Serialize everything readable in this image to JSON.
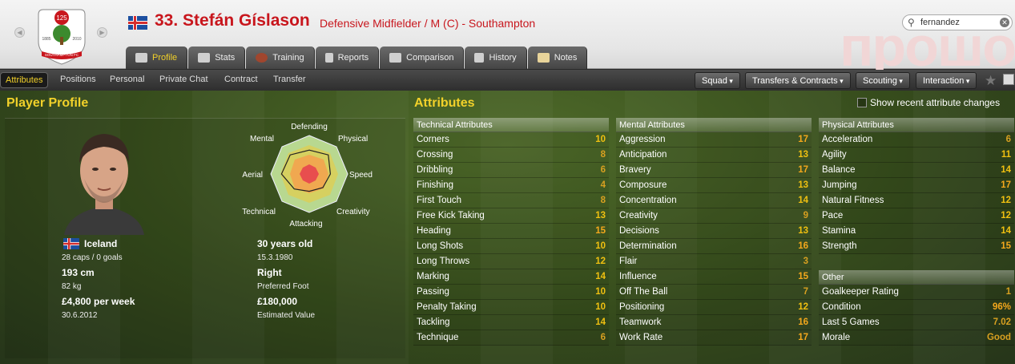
{
  "header": {
    "player_number_name": "33. Stefán Gíslason",
    "role_club": "Defensive Midfielder / M (C) - Southampton",
    "crest": {
      "top_number": "125",
      "year_left": "1885",
      "year_right": "2010",
      "banner": "SOUTHAMPTON FC"
    },
    "search_value": "fernandez",
    "watermark": "прошо",
    "flag_icon": "iceland-flag-icon"
  },
  "tabs": [
    {
      "label": "Profile",
      "icon": "profile-icon",
      "active": true
    },
    {
      "label": "Stats",
      "icon": "stats-icon"
    },
    {
      "label": "Training",
      "icon": "training-icon"
    },
    {
      "label": "Reports",
      "icon": "reports-icon"
    },
    {
      "label": "Comparison",
      "icon": "comparison-icon"
    },
    {
      "label": "History",
      "icon": "history-icon"
    },
    {
      "label": "Notes",
      "icon": "notes-icon"
    }
  ],
  "subtabs": [
    "Attributes",
    "Positions",
    "Personal",
    "Private Chat",
    "Contract",
    "Transfer"
  ],
  "menus": [
    "Squad",
    "Transfers & Contracts",
    "Scouting",
    "Interaction"
  ],
  "profile": {
    "title": "Player Profile",
    "radar_labels": [
      "Defending",
      "Physical",
      "Speed",
      "Creativity",
      "Attacking",
      "Technical",
      "Aerial",
      "Mental"
    ],
    "radar_values": {
      "Defending": 0.62,
      "Physical": 0.7,
      "Speed": 0.55,
      "Creativity": 0.5,
      "Attacking": 0.45,
      "Technical": 0.55,
      "Aerial": 0.72,
      "Mental": 0.7
    },
    "nation": "Iceland",
    "caps": "28 caps / 0 goals",
    "height": "193 cm",
    "weight": "82 kg",
    "wage": "£4,800 per week",
    "contract_end": "30.6.2012",
    "age": "30 years old",
    "dob": "15.3.1980",
    "foot": "Right",
    "foot_label": "Preferred Foot",
    "value": "£180,000",
    "value_label": "Estimated Value"
  },
  "attributes": {
    "title": "Attributes",
    "show_changes": "Show recent attribute changes",
    "technical": {
      "header": "Technical Attributes",
      "rows": [
        {
          "name": "Corners",
          "value": "10"
        },
        {
          "name": "Crossing",
          "value": "8"
        },
        {
          "name": "Dribbling",
          "value": "6"
        },
        {
          "name": "Finishing",
          "value": "4"
        },
        {
          "name": "First Touch",
          "value": "8"
        },
        {
          "name": "Free Kick Taking",
          "value": "13"
        },
        {
          "name": "Heading",
          "value": "15"
        },
        {
          "name": "Long Shots",
          "value": "10"
        },
        {
          "name": "Long Throws",
          "value": "12"
        },
        {
          "name": "Marking",
          "value": "14"
        },
        {
          "name": "Passing",
          "value": "10"
        },
        {
          "name": "Penalty Taking",
          "value": "10"
        },
        {
          "name": "Tackling",
          "value": "14"
        },
        {
          "name": "Technique",
          "value": "6"
        }
      ]
    },
    "mental": {
      "header": "Mental Attributes",
      "rows": [
        {
          "name": "Aggression",
          "value": "17"
        },
        {
          "name": "Anticipation",
          "value": "13"
        },
        {
          "name": "Bravery",
          "value": "17"
        },
        {
          "name": "Composure",
          "value": "13"
        },
        {
          "name": "Concentration",
          "value": "14"
        },
        {
          "name": "Creativity",
          "value": "9"
        },
        {
          "name": "Decisions",
          "value": "13"
        },
        {
          "name": "Determination",
          "value": "16"
        },
        {
          "name": "Flair",
          "value": "3"
        },
        {
          "name": "Influence",
          "value": "15"
        },
        {
          "name": "Off The Ball",
          "value": "7"
        },
        {
          "name": "Positioning",
          "value": "12"
        },
        {
          "name": "Teamwork",
          "value": "16"
        },
        {
          "name": "Work Rate",
          "value": "17"
        }
      ]
    },
    "physical": {
      "header": "Physical Attributes",
      "rows": [
        {
          "name": "Acceleration",
          "value": "6"
        },
        {
          "name": "Agility",
          "value": "11"
        },
        {
          "name": "Balance",
          "value": "14"
        },
        {
          "name": "Jumping",
          "value": "17"
        },
        {
          "name": "Natural Fitness",
          "value": "12"
        },
        {
          "name": "Pace",
          "value": "12"
        },
        {
          "name": "Stamina",
          "value": "14"
        },
        {
          "name": "Strength",
          "value": "15"
        }
      ]
    },
    "other": {
      "header": "Other",
      "rows": [
        {
          "name": "Goalkeeper Rating",
          "value": "1"
        },
        {
          "name": "Condition",
          "value": "96%"
        },
        {
          "name": "Last 5 Games",
          "value": "7.02"
        },
        {
          "name": "Morale",
          "value": "Good"
        }
      ]
    }
  },
  "colors": {
    "accent": "#f2d12a",
    "name_red": "#c8161d",
    "val_low": "#d8a020",
    "val_mid": "#f0c010",
    "val_high": "#f4a81c"
  }
}
